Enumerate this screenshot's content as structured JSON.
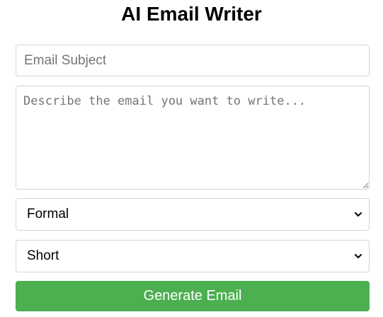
{
  "app": {
    "title": "AI Email Writer"
  },
  "form": {
    "subject": {
      "value": "",
      "placeholder": "Email Subject"
    },
    "description": {
      "value": "",
      "placeholder": "Describe the email you want to write..."
    },
    "tone": {
      "selected": "Formal",
      "icon": "chevron-down-icon"
    },
    "length": {
      "selected": "Short",
      "icon": "chevron-down-icon"
    },
    "generate_label": "Generate Email"
  },
  "colors": {
    "button_bg": "#4caf50",
    "button_text": "#ffffff",
    "border": "#d6d6d6",
    "placeholder": "#757575"
  }
}
